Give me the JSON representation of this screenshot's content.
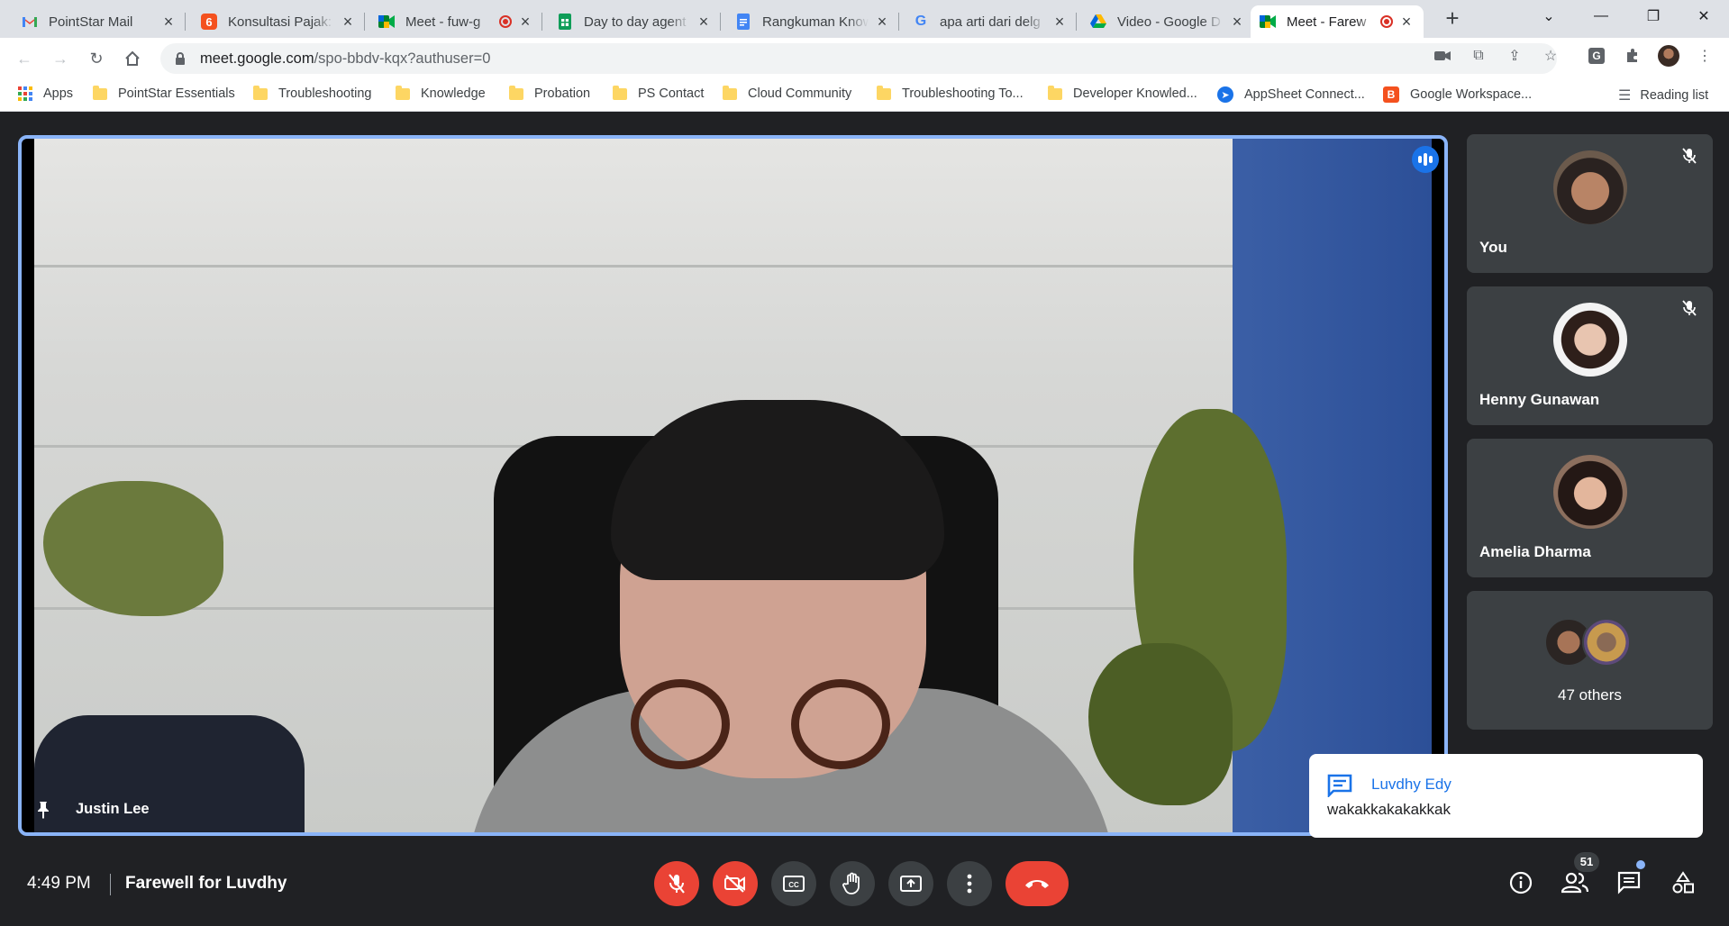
{
  "browser": {
    "tabs": [
      {
        "title": "PointStar Mail",
        "icon": "gmail-icon",
        "recording": false,
        "active": false
      },
      {
        "title": "Konsultasi Pajak: f",
        "icon": "tax-site-icon",
        "recording": false,
        "active": false
      },
      {
        "title": "Meet - fuw-g",
        "icon": "google-meet-icon",
        "recording": true,
        "active": false
      },
      {
        "title": "Day to day agent",
        "icon": "google-sheets-icon",
        "recording": false,
        "active": false
      },
      {
        "title": "Rangkuman Know",
        "icon": "google-docs-icon",
        "recording": false,
        "active": false
      },
      {
        "title": "apa arti dari delg",
        "icon": "google-search-icon",
        "recording": false,
        "active": false
      },
      {
        "title": "Video - Google D",
        "icon": "google-drive-icon",
        "recording": false,
        "active": false
      },
      {
        "title": "Meet - Farew",
        "icon": "google-meet-icon",
        "recording": true,
        "active": true
      }
    ],
    "url_host": "meet.google.com",
    "url_path": "/spo-bbdv-kqx?authuser=0",
    "bookmarks": [
      {
        "label": "Apps",
        "icon": "apps-grid-icon"
      },
      {
        "label": "PointStar Essentials",
        "icon": "folder-icon"
      },
      {
        "label": "Troubleshooting",
        "icon": "folder-icon"
      },
      {
        "label": "Knowledge",
        "icon": "folder-icon"
      },
      {
        "label": "Probation",
        "icon": "folder-icon"
      },
      {
        "label": "PS Contact",
        "icon": "folder-icon"
      },
      {
        "label": "Cloud Community",
        "icon": "folder-icon"
      },
      {
        "label": "Troubleshooting To...",
        "icon": "folder-icon"
      },
      {
        "label": "Developer Knowled...",
        "icon": "folder-icon"
      },
      {
        "label": "AppSheet Connect...",
        "icon": "appsheet-icon"
      },
      {
        "label": "Google Workspace...",
        "icon": "blogger-icon"
      }
    ],
    "reading_list": "Reading list"
  },
  "meet": {
    "main_speaker": "Justin Lee",
    "participants": [
      {
        "name": "You",
        "muted": true
      },
      {
        "name": "Henny Gunawan",
        "muted": true
      },
      {
        "name": "Amelia Dharma",
        "muted": false
      }
    ],
    "others_label": "47 others",
    "chat_toast": {
      "sender": "Luvdhy Edy",
      "message": "wakakkakakakkak"
    },
    "time": "4:49 PM",
    "meeting_title": "Farewell for Luvdhy",
    "people_count": "51"
  },
  "colors": {
    "accent": "#1a73e8",
    "danger": "#ea4335",
    "meet_bg": "#202124",
    "tile_bg": "#3c4043"
  }
}
